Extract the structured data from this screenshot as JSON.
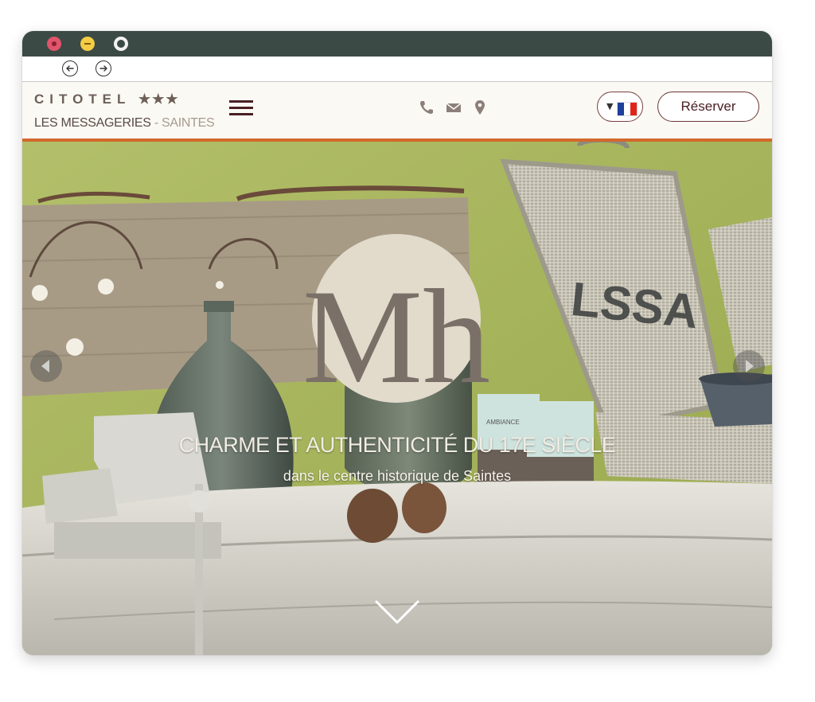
{
  "window": {
    "controls": [
      "close",
      "minimize",
      "fullscreen"
    ],
    "nav": {
      "back_icon": "arrow-left-circle-icon",
      "forward_icon": "arrow-right-circle-icon"
    }
  },
  "header": {
    "logo_brand": "CITOTEL",
    "logo_stars": "★★★",
    "logo_hotel_name": "LES MESSAGERIES",
    "logo_separator": " - ",
    "logo_city": "SAINTES",
    "contact_icons": [
      "phone-icon",
      "mail-icon",
      "location-pin-icon"
    ],
    "language_caret": "▼",
    "language_flag": "fr-flag-icon",
    "reserve_label": "Réserver",
    "accent_color": "#d2692b",
    "brand_color": "#4a1f22"
  },
  "hero": {
    "monogram": "Mh",
    "title": "CHARME ET AUTHENTICITÉ DU 17E SIÈCLE",
    "subtitle": "dans le centre historique de Saintes",
    "basket_text": "LSSA",
    "candle_label": "AMBIANCE",
    "prev_icon": "chevron-left-icon",
    "next_icon": "chevron-right-icon",
    "scroll_icon": "chevron-down-icon"
  }
}
